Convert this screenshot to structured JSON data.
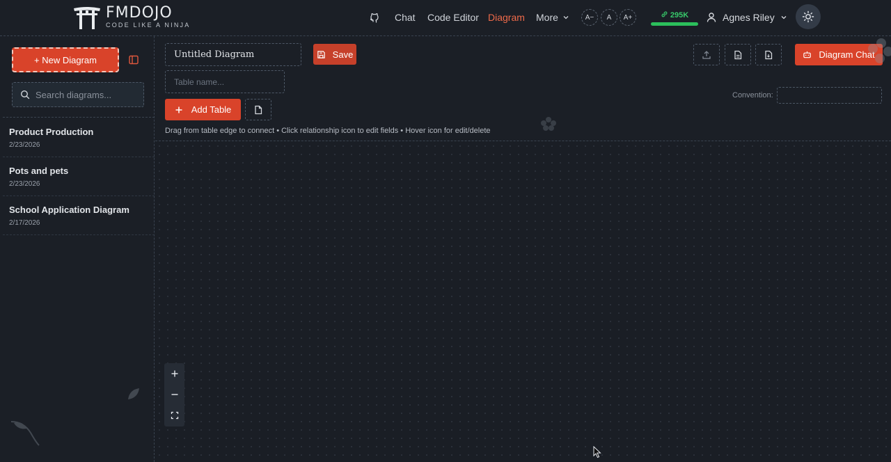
{
  "header": {
    "logo_title": "FMDOJO",
    "logo_subtitle": "CODE LIKE A NINJA",
    "nav": {
      "chat": "Chat",
      "code_editor": "Code Editor",
      "diagram": "Diagram",
      "more": "More"
    },
    "font_sizes": [
      "A−",
      "A",
      "A+"
    ],
    "credits": "295K",
    "user_name": "Agnes Riley"
  },
  "sidebar": {
    "new_diagram_label": "+ New Diagram",
    "search_placeholder": "Search diagrams...",
    "diagrams": [
      {
        "name": "Product Production",
        "date": "2/23/2026"
      },
      {
        "name": "Pots and pets",
        "date": "2/23/2026"
      },
      {
        "name": "School Application Diagram",
        "date": "2/17/2026"
      }
    ]
  },
  "toolbar": {
    "diagram_title": "Untitled Diagram",
    "save_label": "Save",
    "table_name_placeholder": "Table name...",
    "add_table_label": "Add Table",
    "hint": "Drag from table edge to connect • Click relationship icon to edit fields • Hover icon for edit/delete",
    "diagram_chat_label": "Diagram Chat",
    "convention_label": "Convention:"
  },
  "colors": {
    "accent": "#d9432a",
    "active_nav": "#ef6a4a",
    "credits": "#2bbf5b",
    "background": "#1a1e25"
  },
  "icons": [
    "github-icon",
    "chevron-down-icon",
    "link-icon",
    "user-icon",
    "sun-icon",
    "sidebar-toggle-icon",
    "search-icon",
    "save-icon",
    "plus-icon",
    "document-icon",
    "upload-icon",
    "robot-icon",
    "zoom-in-icon",
    "zoom-out-icon",
    "fit-view-icon"
  ]
}
